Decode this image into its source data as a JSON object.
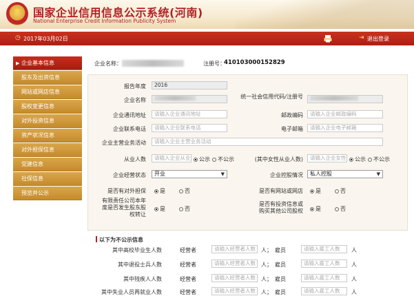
{
  "header": {
    "title_cn": "国家企业信用信息公示系统(河南)",
    "title_en": "National Enterprise Credit Information Publicity System"
  },
  "toolbar": {
    "date": "2017年03月02日",
    "logout_label": "退出登录"
  },
  "sidebar": {
    "items": [
      {
        "label": "企业基本信息",
        "active": true
      },
      {
        "label": "股东及出资信息"
      },
      {
        "label": "网站或网店信息"
      },
      {
        "label": "股权变更信息"
      },
      {
        "label": "对外投资信息"
      },
      {
        "label": "资产状况信息"
      },
      {
        "label": "对外担保信息"
      },
      {
        "label": "党建信息"
      },
      {
        "label": "社保信息"
      },
      {
        "label": "预览并公示"
      }
    ]
  },
  "company": {
    "name_label": "企业名称：",
    "reg_label": "注册号：",
    "reg_no": "410103000152829"
  },
  "form": {
    "year_label": "报告年度",
    "year_value": "2016",
    "name_label": "企业名称",
    "credit_code_label": "统一社会信用代码/注册号",
    "address_label": "企业通讯地址",
    "address_placeholder": "请输入企业通讯地址",
    "postcode_label": "邮政编码",
    "postcode_placeholder": "请输入企业邮政编码",
    "phone_label": "企业联系电话",
    "phone_placeholder": "请输入企业联系电话",
    "email_label": "电子邮箱",
    "email_placeholder": "请输入企业电子邮箱",
    "business_label": "企业主营业务活动",
    "business_placeholder": "请输入企业主营业务活动",
    "staff_label": "从业人数",
    "staff_placeholder": "请输入企业从业",
    "female_label": "(其中女性从业人数)",
    "female_placeholder": "请输入企业女性",
    "public_label": "公示",
    "nonpublic_label": "不公示",
    "status_label": "企业经营状态",
    "status_value": "开业",
    "holding_label": "企业控股情况",
    "holding_value": "私人控股",
    "guarantee_label": "是否有对外担保",
    "website_label": "是否有网站或网店",
    "equity_label_1": "有限责任公司本年",
    "equity_label_2": "度是否发生股东股",
    "equity_label_3": "权转让",
    "invest_label_1": "是否有投资信息或",
    "invest_label_2": "购买其他公司股权",
    "yes_label": "是",
    "no_label": "否"
  },
  "section": {
    "title": "以下为不公示信息",
    "rows": [
      {
        "label": "其中高校毕业生人数"
      },
      {
        "label": "其中退役士兵人数"
      },
      {
        "label": "其中残疾人人数"
      },
      {
        "label": "其中失业人员再就业人数"
      }
    ],
    "manager_label": "经营者",
    "employee_label": "雇员",
    "manager_placeholder": "请输入经营者人数",
    "employee_placeholder": "请输入雇工人数",
    "unit": "人；",
    "unit_end": "人"
  }
}
